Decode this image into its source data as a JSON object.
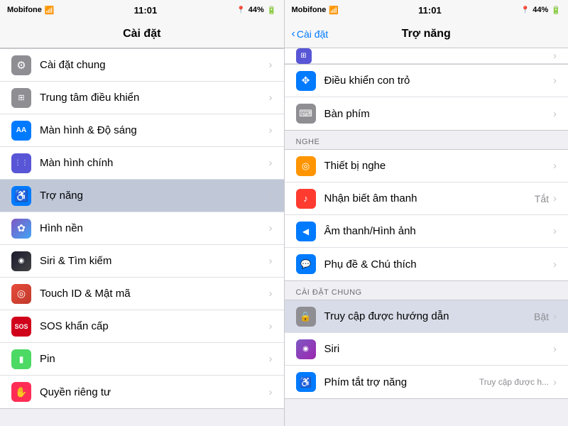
{
  "left_panel": {
    "status_bar": {
      "carrier": "Mobifone",
      "time": "11:01",
      "battery": "44%"
    },
    "nav": {
      "title": "Cài đặt"
    },
    "items": [
      {
        "id": "cai-dat-chung",
        "label": "Cài đặt chung",
        "icon_color": "icon-gray",
        "icon_char": "⚙"
      },
      {
        "id": "trung-tam-dieu-khien",
        "label": "Trung tâm điều khiển",
        "icon_color": "icon-gray",
        "icon_char": "⊞"
      },
      {
        "id": "man-hinh-do-sang",
        "label": "Màn hình & Độ sáng",
        "icon_color": "icon-blue",
        "icon_char": "AA"
      },
      {
        "id": "man-hinh-chinh",
        "label": "Màn hình chính",
        "icon_color": "icon-indigo",
        "icon_char": "⋮⋮"
      },
      {
        "id": "tro-nang",
        "label": "Trợ năng",
        "icon_color": "icon-acc-blue",
        "icon_char": "⓪",
        "selected": true
      },
      {
        "id": "hinh-nen",
        "label": "Hình nền",
        "icon_color": "icon-teal",
        "icon_char": "✿"
      },
      {
        "id": "siri-tim-kiem",
        "label": "Siri & Tìm kiếm",
        "icon_color": "icon-siri-dark",
        "icon_char": "◉"
      },
      {
        "id": "touch-id",
        "label": "Touch ID & Mật mã",
        "icon_color": "icon-touch",
        "icon_char": "◎"
      },
      {
        "id": "sos-khan-cap",
        "label": "SOS khẩn cấp",
        "icon_color": "icon-sos-red",
        "icon_char": "SOS"
      },
      {
        "id": "pin",
        "label": "Pin",
        "icon_color": "icon-green",
        "icon_char": "▮"
      },
      {
        "id": "quyen-rieng-tu",
        "label": "Quyền riêng tư",
        "icon_color": "icon-pink",
        "icon_char": "✋"
      }
    ]
  },
  "right_panel": {
    "status_bar": {
      "carrier": "Mobifone",
      "time": "11:01",
      "battery": "44%"
    },
    "nav": {
      "back_label": "Cài đặt",
      "title": "Trợ năng"
    },
    "partial_item": {
      "label": ""
    },
    "sections": [
      {
        "id": "no-header",
        "items": [
          {
            "id": "dieu-khien-con-tro",
            "label": "Điều khiển con trỏ",
            "icon_color": "icon-blue",
            "icon_char": "⊹"
          },
          {
            "id": "ban-phim",
            "label": "Bàn phím",
            "icon_color": "icon-gray",
            "icon_char": "⌨"
          }
        ]
      },
      {
        "id": "nghe",
        "header": "NGHE",
        "items": [
          {
            "id": "thiet-bi-nghe",
            "label": "Thiết bị nghe",
            "icon_color": "icon-orange",
            "icon_char": "◎"
          },
          {
            "id": "nhan-biet-am-thanh",
            "label": "Nhận biết âm thanh",
            "icon_color": "icon-red",
            "icon_char": "♪",
            "value": "Tắt"
          },
          {
            "id": "am-thanh-hinh-anh",
            "label": "Âm thanh/Hình ảnh",
            "icon_color": "icon-blue",
            "icon_char": "◀"
          },
          {
            "id": "phu-de-chu-thich",
            "label": "Phụ đề & Chú thích",
            "icon_color": "icon-blue",
            "icon_char": "💬"
          }
        ]
      },
      {
        "id": "cai-dat-chung",
        "header": "CÀI ĐẶT CHUNG",
        "items": [
          {
            "id": "truy-cap-duoc-huong-dan",
            "label": "Truy cập được hướng dẫn",
            "icon_color": "icon-gray",
            "icon_char": "🔒",
            "value": "Bật",
            "selected": true
          },
          {
            "id": "siri",
            "label": "Siri",
            "icon_color": "icon-purple",
            "icon_char": "◉"
          },
          {
            "id": "phim-tat-tro-nang",
            "label": "Phím tắt trợ năng",
            "icon_color": "icon-acc-blue",
            "icon_char": "⓪",
            "value": "Truy cập được h..."
          }
        ]
      }
    ]
  }
}
